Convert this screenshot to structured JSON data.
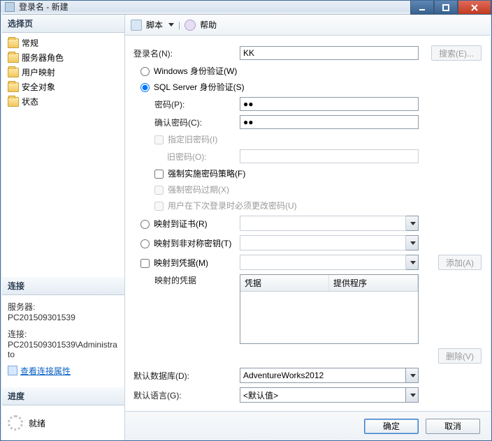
{
  "window": {
    "title": "登录名 - 新建"
  },
  "sidebar": {
    "select_header": "选择页",
    "items": [
      {
        "label": "常规"
      },
      {
        "label": "服务器角色"
      },
      {
        "label": "用户映射"
      },
      {
        "label": "安全对象"
      },
      {
        "label": "状态"
      }
    ],
    "connection_header": "连接",
    "server_label": "服务器:",
    "server_value": "PC201509301539",
    "conn_label": "连接:",
    "conn_value": "PC201509301539\\Administrato",
    "view_props": "查看连接属性",
    "progress_header": "进度",
    "progress_status": "就绪"
  },
  "toolbar": {
    "script": "脚本",
    "help": "帮助"
  },
  "form": {
    "login_label": "登录名(N):",
    "login_value": "KK",
    "search_btn": "搜索(E)...",
    "auth_windows": "Windows 身份验证(W)",
    "auth_sql": "SQL Server 身份验证(S)",
    "password_label": "密码(P):",
    "password_value": "●●",
    "confirm_label": "确认密码(C):",
    "confirm_value": "●●",
    "specify_old": "指定旧密码(I)",
    "old_pwd_label": "旧密码(O):",
    "enforce_policy": "强制实施密码策略(F)",
    "enforce_expire": "强制密码过期(X)",
    "must_change": "用户在下次登录时必须更改密码(U)",
    "map_cert": "映射到证书(R)",
    "map_asym": "映射到非对称密钥(T)",
    "map_cred": "映射到凭据(M)",
    "add_btn": "添加(A)",
    "mapped_creds_label": "映射的凭据",
    "grid_col1": "凭据",
    "grid_col2": "提供程序",
    "remove_btn": "删除(V)",
    "default_db_label": "默认数据库(D):",
    "default_db_value": "AdventureWorks2012",
    "default_lang_label": "默认语言(G):",
    "default_lang_value": "<默认值>"
  },
  "footer": {
    "ok": "确定",
    "cancel": "取消"
  }
}
